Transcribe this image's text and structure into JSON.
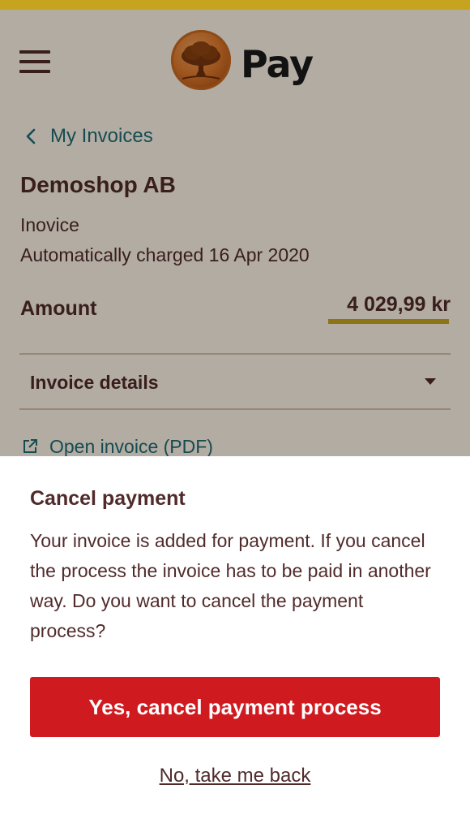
{
  "header": {
    "logo_text": "Pay",
    "menu_icon": "hamburger-menu-icon",
    "logo_icon": "oak-tree-coin-logo",
    "accent_color": "#c7a41f"
  },
  "navigation": {
    "back_label": "My Invoices",
    "back_icon": "chevron-left-icon"
  },
  "invoice": {
    "merchant": "Demoshop AB",
    "document_type": "Inovice",
    "charge_info": "Automatically charged 16 Apr 2020",
    "amount_label": "Amount",
    "amount_value": "4 029,99 kr",
    "details_label": "Invoice details",
    "details_icon": "caret-down-icon",
    "pdf_label": "Open invoice (PDF)",
    "pdf_icon": "external-link-icon"
  },
  "dialog": {
    "title": "Cancel payment",
    "body": "Your invoice is added for payment. If you cancel the process the invoice has to be paid in another way. Do you want to cancel the payment process?",
    "confirm_label": "Yes, cancel payment process",
    "back_label": "No, take me back",
    "confirm_color": "#cf1b20",
    "text_color": "#512b2b",
    "link_color": "#1f6b73"
  }
}
